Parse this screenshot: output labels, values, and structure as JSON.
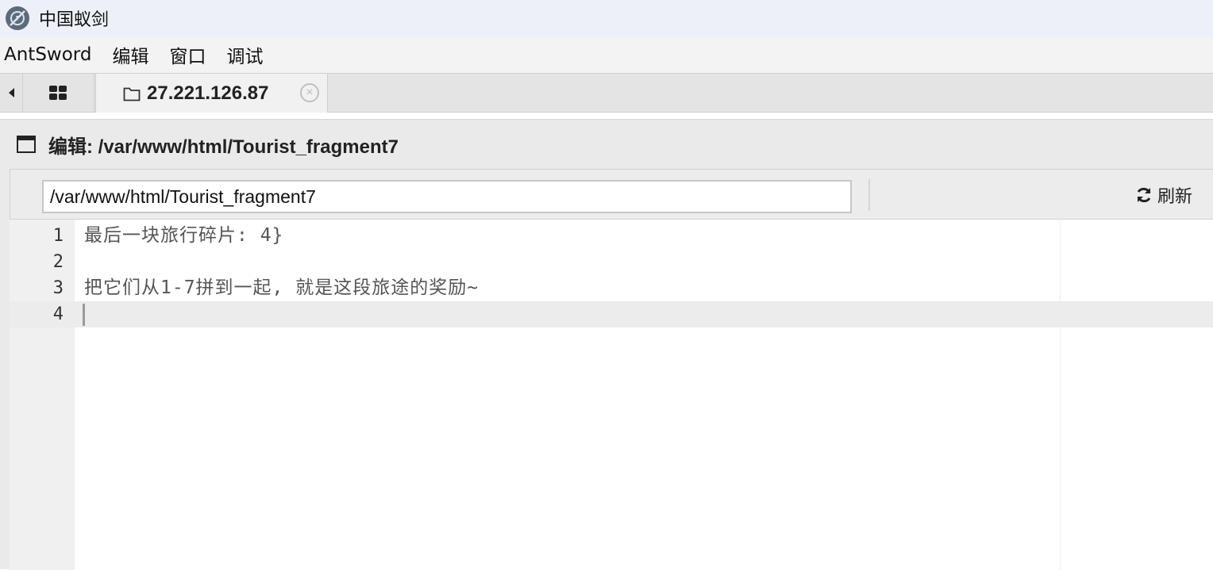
{
  "app": {
    "title": "中国蚁剑",
    "logo_icon": "antsword-logo-icon"
  },
  "menu": [
    "AntSword",
    "编辑",
    "窗口",
    "调试"
  ],
  "tabs": {
    "home_icon": "grid-icon",
    "active": {
      "label": "27.221.126.87",
      "icon": "folder-icon",
      "close_icon": "close-circle-icon"
    }
  },
  "editor": {
    "title": "编辑: /var/www/html/Tourist_fragment7",
    "path_value": "/var/www/html/Tourist_fragment7",
    "refresh_label": "刷新",
    "lines": [
      {
        "num": "1",
        "text": "最后一块旅行碎片: 4}"
      },
      {
        "num": "2",
        "text": ""
      },
      {
        "num": "3",
        "text": "把它们从1-7拼到一起, 就是这段旅途的奖励~"
      },
      {
        "num": "4",
        "text": ""
      }
    ],
    "active_line": 4
  },
  "colors": {
    "titlebar_bg": "#eef0f9",
    "editor_active_line": "#ececec",
    "gutter_bg": "#f0f0f0"
  }
}
